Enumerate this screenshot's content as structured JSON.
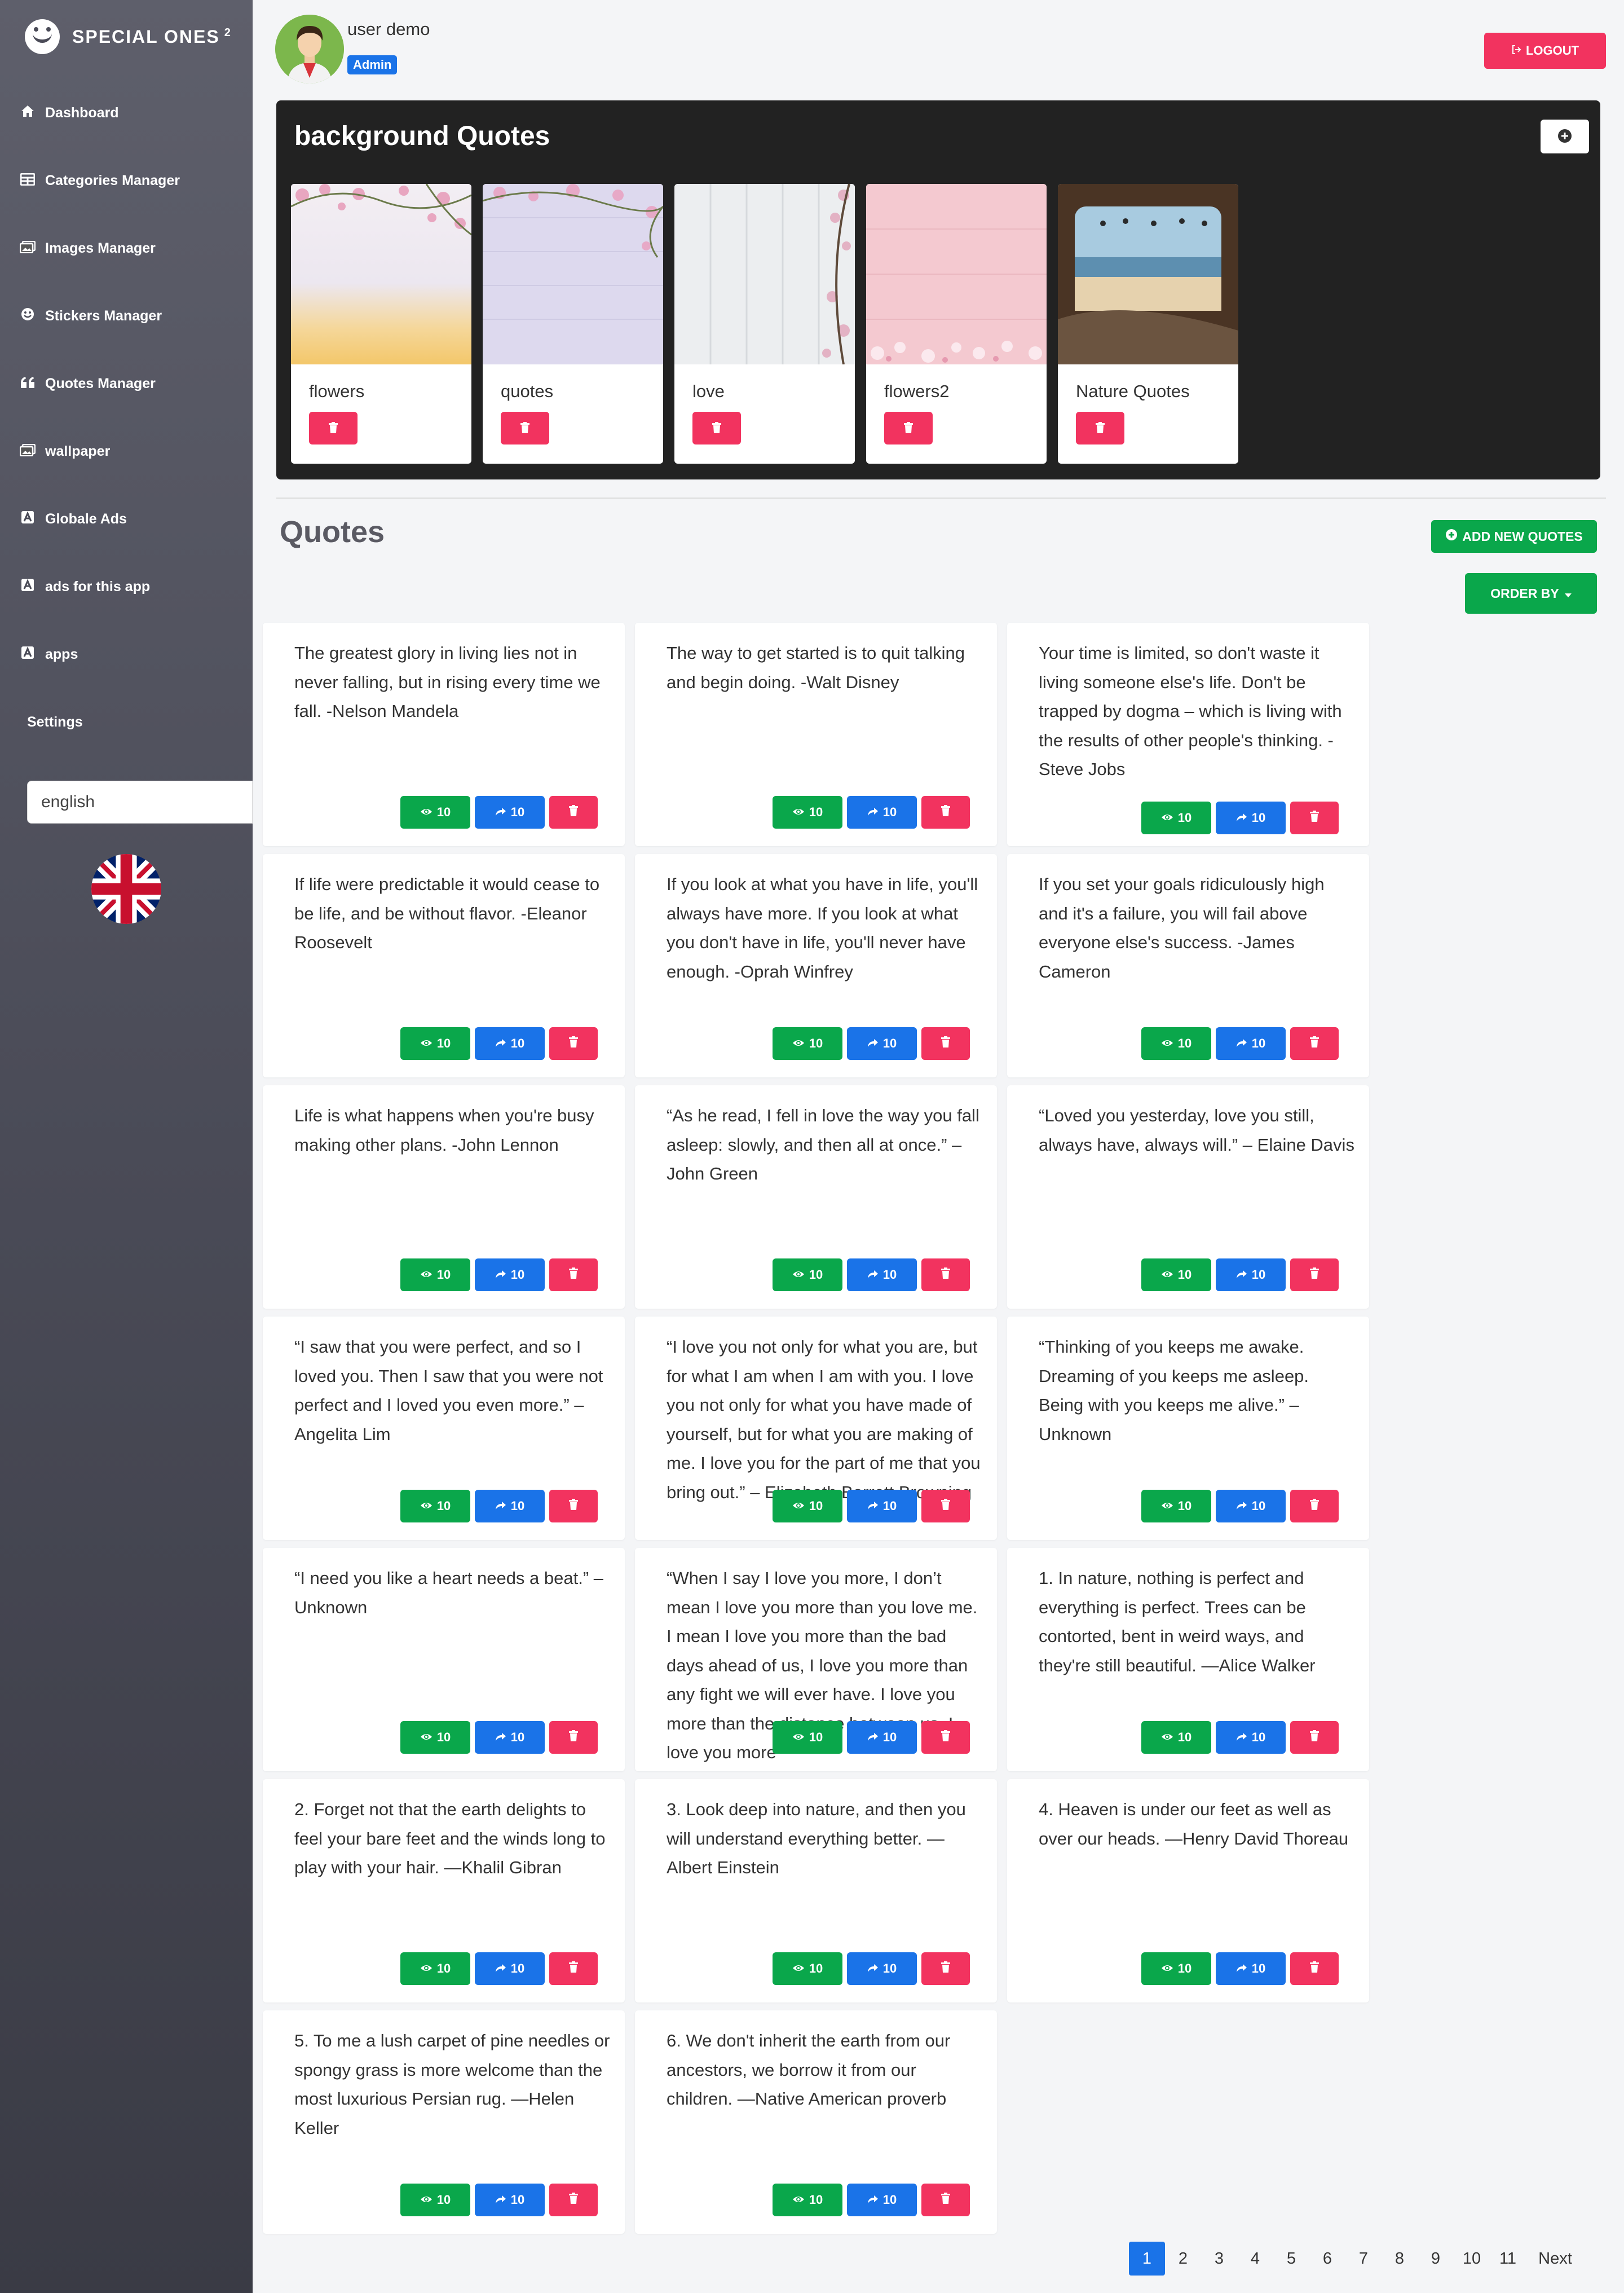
{
  "app": {
    "name": "SPECIAL ONES",
    "version": "2"
  },
  "sidebar": {
    "items": [
      {
        "label": "Dashboard",
        "icon": "home-icon"
      },
      {
        "label": "Categories Manager",
        "icon": "table-icon"
      },
      {
        "label": "Images Manager",
        "icon": "images-icon"
      },
      {
        "label": "Stickers Manager",
        "icon": "smile-icon"
      },
      {
        "label": "Quotes Manager",
        "icon": "quote-icon"
      },
      {
        "label": "wallpaper",
        "icon": "images-icon"
      },
      {
        "label": "Globale Ads",
        "icon": "ad-icon"
      },
      {
        "label": "ads for this app",
        "icon": "ad-icon"
      },
      {
        "label": "apps",
        "icon": "ad-icon"
      },
      {
        "label": "Settings",
        "icon": ""
      }
    ],
    "language": "english",
    "flag_icon": "uk-flag-icon"
  },
  "header": {
    "username": "user demo",
    "role": "Admin",
    "logout_label": "LOGOUT"
  },
  "background_quotes": {
    "title": "background Quotes",
    "cards": [
      {
        "name": "flowers"
      },
      {
        "name": "quotes"
      },
      {
        "name": "love"
      },
      {
        "name": "flowers2"
      },
      {
        "name": "Nature Quotes"
      }
    ]
  },
  "quotes": {
    "title": "Quotes",
    "add_label": "ADD NEW QUOTES",
    "order_label": "ORDER BY",
    "items": [
      {
        "text": "The greatest glory in living lies not in never falling, but in rising every time we fall. -Nelson Mandela",
        "views": "10",
        "shares": "10"
      },
      {
        "text": "The way to get started is to quit talking and begin doing. -Walt Disney",
        "views": "10",
        "shares": "10"
      },
      {
        "text": "Your time is limited, so don't waste it living someone else's life. Don't be trapped by dogma – which is living with the results of other people's thinking. -Steve Jobs",
        "views": "10",
        "shares": "10"
      },
      {
        "text": "If life were predictable it would cease to be life, and be without flavor. -Eleanor Roosevelt",
        "views": "10",
        "shares": "10"
      },
      {
        "text": "If you look at what you have in life, you'll always have more. If you look at what you don't have in life, you'll never have enough. -Oprah Winfrey",
        "views": "10",
        "shares": "10"
      },
      {
        "text": "If you set your goals ridiculously high and it's a failure, you will fail above everyone else's success. -James Cameron",
        "views": "10",
        "shares": "10"
      },
      {
        "text": "Life is what happens when you're busy making other plans. -John Lennon",
        "views": "10",
        "shares": "10"
      },
      {
        "text": "“As he read, I fell in love the way you fall asleep: slowly, and then all at once.” – John Green",
        "views": "10",
        "shares": "10"
      },
      {
        "text": "“Loved you yesterday, love you still, always have, always will.” – Elaine Davis",
        "views": "10",
        "shares": "10"
      },
      {
        "text": "“I saw that you were perfect, and so I loved you. Then I saw that you were not perfect and I loved you even more.” – Angelita Lim",
        "views": "10",
        "shares": "10"
      },
      {
        "text": "“I love you not only for what you are, but for what I am when I am with you. I love you not only for what you have made of yourself, but for what you are making of me. I love you for the part of me that you bring out.” – Elizabeth Barrett Browning",
        "views": "10",
        "shares": "10"
      },
      {
        "text": "“Thinking of you keeps me awake. Dreaming of you keeps me asleep. Being with you keeps me alive.” – Unknown",
        "views": "10",
        "shares": "10"
      },
      {
        "text": "“I need you like a heart needs a beat.” – Unknown",
        "views": "10",
        "shares": "10"
      },
      {
        "text": "“When I say I love you more, I don’t mean I love you more than you love me. I mean I love you more than the bad days ahead of us, I love you more than any fight we will ever have. I love you more than the distance between us, I love you more",
        "views": "10",
        "shares": "10"
      },
      {
        "text": "1. In nature, nothing is perfect and everything is perfect. Trees can be contorted, bent in weird ways, and they're still beautiful. —Alice Walker",
        "views": "10",
        "shares": "10"
      },
      {
        "text": "2. Forget not that the earth delights to feel your bare feet and the winds long to play with your hair. —Khalil Gibran",
        "views": "10",
        "shares": "10"
      },
      {
        "text": "3. Look deep into nature, and then you will understand everything better. —Albert Einstein",
        "views": "10",
        "shares": "10"
      },
      {
        "text": "4. Heaven is under our feet as well as over our heads. —Henry David Thoreau",
        "views": "10",
        "shares": "10"
      },
      {
        "text": "5. To me a lush carpet of pine needles or spongy grass is more welcome than the most luxurious Persian rug. —Helen Keller",
        "views": "10",
        "shares": "10"
      },
      {
        "text": "6. We don't inherit the earth from our ancestors, we borrow it from our children. —Native American proverb",
        "views": "10",
        "shares": "10"
      }
    ]
  },
  "pagination": {
    "pages": [
      "1",
      "2",
      "3",
      "4",
      "5",
      "6",
      "7",
      "8",
      "9",
      "10",
      "11"
    ],
    "current": "1",
    "next_label": "Next"
  },
  "colors": {
    "green": "#0aa74b",
    "blue": "#1a73e8",
    "red": "#f2335f",
    "sidebar": "#4a4b57"
  }
}
